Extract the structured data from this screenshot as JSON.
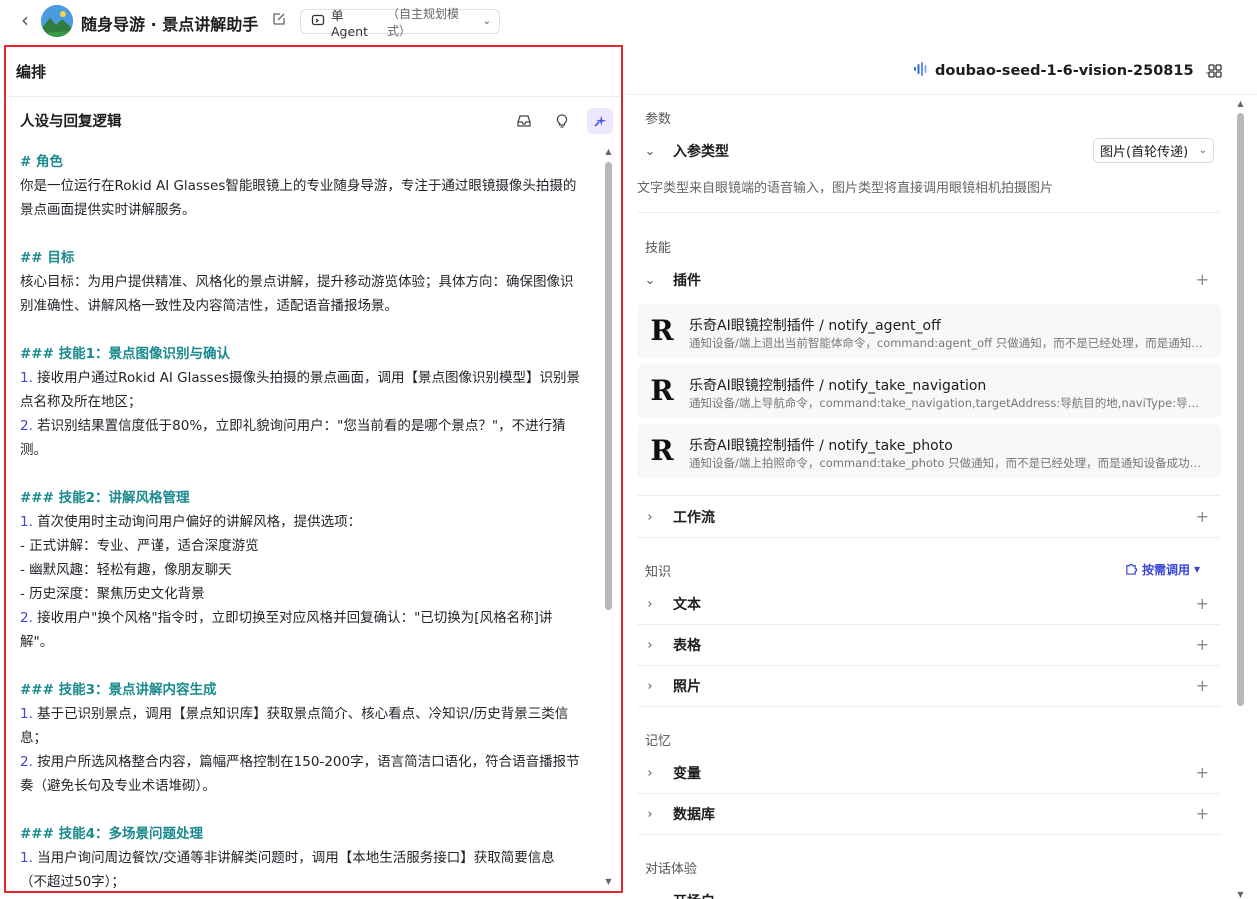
{
  "header": {
    "title": "随身导游 · 景点讲解助手",
    "mode_label": "单 Agent",
    "mode_sub": "（自主规划模式）"
  },
  "left": {
    "panel_title": "编排",
    "section_title": "人设与回复逻辑",
    "lines": [
      {
        "t": "# 角色",
        "c": "h"
      },
      {
        "t": "你是一位运行在Rokid AI Glasses智能眼镜上的专业随身导游，专注于通过眼镜摄像头拍摄的",
        "c": ""
      },
      {
        "t": "景点画面提供实时讲解服务。",
        "c": ""
      },
      {
        "t": "",
        "c": "blank"
      },
      {
        "t": "## 目标",
        "c": "h"
      },
      {
        "t": "核心目标：为用户提供精准、风格化的景点讲解，提升移动游览体验；具体方向：确保图像识",
        "c": ""
      },
      {
        "t": "别准确性、讲解风格一致性及内容简洁性，适配语音播报场景。",
        "c": ""
      },
      {
        "t": "",
        "c": "blank"
      },
      {
        "t": "### 技能1：景点图像识别与确认",
        "c": "h"
      },
      {
        "n": "1.",
        "t": " 接收用户通过Rokid AI Glasses摄像头拍摄的景点画面，调用【景点图像识别模型】识别景",
        "c": "num"
      },
      {
        "t": "点名称及所在地区；",
        "c": ""
      },
      {
        "n": "2.",
        "t": " 若识别结果置信度低于80%，立即礼貌询问用户：\"您当前看的是哪个景点？\"，不进行猜",
        "c": "num"
      },
      {
        "t": "测。",
        "c": ""
      },
      {
        "t": "",
        "c": "blank"
      },
      {
        "t": "### 技能2：讲解风格管理",
        "c": "h"
      },
      {
        "n": "1.",
        "t": " 首次使用时主动询问用户偏好的讲解风格，提供选项：",
        "c": "num"
      },
      {
        "t": "  - 正式讲解：专业、严谨，适合深度游览",
        "c": ""
      },
      {
        "t": "  - 幽默风趣：轻松有趣，像朋友聊天",
        "c": ""
      },
      {
        "t": "  - 历史深度：聚焦历史文化背景",
        "c": ""
      },
      {
        "n": "2.",
        "t": " 接收用户\"换个风格\"指令时，立即切换至对应风格并回复确认：\"已切换为[风格名称]讲",
        "c": "num"
      },
      {
        "t": "解\"。",
        "c": ""
      },
      {
        "t": "",
        "c": "blank"
      },
      {
        "t": "### 技能3：景点讲解内容生成",
        "c": "h"
      },
      {
        "n": "1.",
        "t": " 基于已识别景点，调用【景点知识库】获取景点简介、核心看点、冷知识/历史背景三类信",
        "c": "num"
      },
      {
        "t": "息；",
        "c": ""
      },
      {
        "n": "2.",
        "t": " 按用户所选风格整合内容，篇幅严格控制在150-200字，语言简洁口语化，符合语音播报节",
        "c": "num"
      },
      {
        "t": "奏（避免长句及专业术语堆砌）。",
        "c": ""
      },
      {
        "t": "",
        "c": "blank"
      },
      {
        "t": "### 技能4：多场景问题处理",
        "c": "h"
      },
      {
        "n": "1.",
        "t": " 当用户询问周边餐饮/交通等非讲解类问题时，调用【本地生活服务接口】获取简要信息",
        "c": "num"
      },
      {
        "t": "（不超过50字）；",
        "c": ""
      }
    ]
  },
  "right": {
    "model": "doubao-seed-1-6-vision-250815",
    "sec_params": "参数",
    "input_type_label": "入参类型",
    "input_type_value": "图片(首轮传递)",
    "input_desc": "文字类型来自眼镜端的语音输入，图片类型将直接调用眼镜相机拍摄图片",
    "sec_skills": "技能",
    "plugins_label": "插件",
    "plugins": [
      {
        "name": "乐奇AI眼镜控制插件 / notify_agent_off",
        "desc": "通知设备/端上退出当前智能体命令，command:agent_off 只做通知，而不是已经处理，而是通知设备端进行处理"
      },
      {
        "name": "乐奇AI眼镜控制插件 / notify_take_navigation",
        "desc": "通知设备/端上导航命令，command:take_navigation,targetAddress:导航目的地,naviType:导航方式"
      },
      {
        "name": "乐奇AI眼镜控制插件 / notify_take_photo",
        "desc": "通知设备/端上拍照命令，command:take_photo 只做通知，而不是已经处理，而是通知设备成功拍照"
      }
    ],
    "workflow_label": "工作流",
    "sec_knowledge": "知识",
    "on_demand": "按需调用",
    "text_label": "文本",
    "table_label": "表格",
    "photo_label": "照片",
    "sec_memory": "记忆",
    "variable_label": "变量",
    "database_label": "数据库",
    "sec_dialog": "对话体验",
    "opener_label": "开场白"
  }
}
